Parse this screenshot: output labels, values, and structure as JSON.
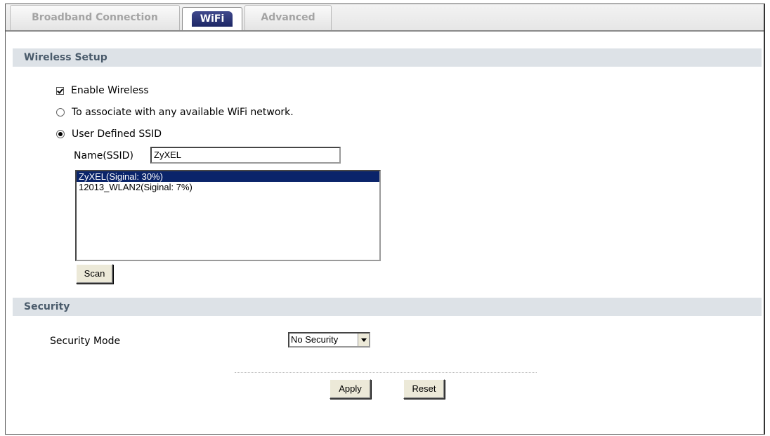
{
  "tabs": [
    {
      "label": "Broadband Connection",
      "active": false
    },
    {
      "label": "WiFi",
      "active": true
    },
    {
      "label": "Advanced",
      "active": false
    }
  ],
  "wireless_setup": {
    "heading": "Wireless Setup",
    "enable_wireless_label": "Enable Wireless",
    "enable_wireless_checked": true,
    "associate_any_label": "To associate with any available WiFi network.",
    "user_defined_label": "User Defined SSID",
    "selected_option": "user_defined",
    "ssid_label": "Name(SSID)",
    "ssid_value": "ZyXEL",
    "networks": [
      {
        "label": "ZyXEL(Siginal: 30%)",
        "selected": true
      },
      {
        "label": "12013_WLAN2(Siginal: 7%)",
        "selected": false
      }
    ],
    "scan_label": "Scan"
  },
  "security": {
    "heading": "Security",
    "mode_label": "Security Mode",
    "mode_value": "No Security"
  },
  "actions": {
    "apply_label": "Apply",
    "reset_label": "Reset"
  }
}
